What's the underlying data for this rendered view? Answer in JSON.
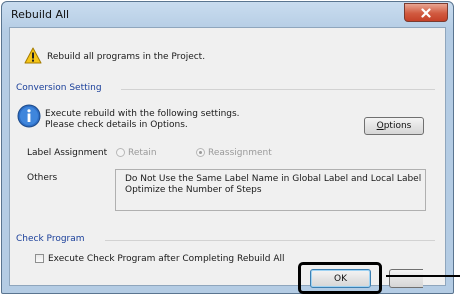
{
  "window": {
    "title": "Rebuild All"
  },
  "header": {
    "message": "Rebuild all programs in the Project."
  },
  "conversion": {
    "group_title": "Conversion Setting",
    "info_line1": "Execute rebuild with the following settings.",
    "info_line2": "Please check details in Options.",
    "options_button_prefix": "O",
    "options_button_rest": "ptions",
    "label_assignment_label": "Label Assignment",
    "retain_label": "Retain",
    "reassignment_label": "Reassignment",
    "selected": "Reassignment",
    "others_label": "Others",
    "others_lines": [
      "Do Not Use the Same Label Name in Global Label and Local Label",
      "Optimize the Number of Steps"
    ]
  },
  "check_program": {
    "group_title": "Check Program",
    "checkbox_label": "Execute Check Program after Completing Rebuild All",
    "checked": false
  },
  "footer": {
    "ok_label": "OK"
  }
}
